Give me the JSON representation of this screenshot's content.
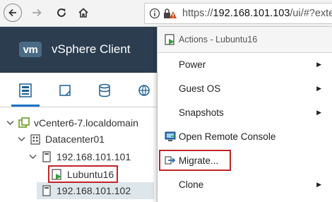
{
  "browser": {
    "address_scheme": "https://",
    "address_host": "192.168.101.103",
    "address_path": "/ui/#?exter"
  },
  "header": {
    "logo": "vm",
    "title": "vSphere Client"
  },
  "navigator": {
    "tabs": [
      "hosts-and-clusters",
      "vms-and-templates",
      "storage",
      "networking"
    ],
    "tree": {
      "vcenter": "vCenter6-7.localdomain",
      "datacenter": "Datacenter01",
      "host1": "192.168.101.101",
      "vm": "Lubuntu16",
      "host2": "192.168.101.102"
    }
  },
  "context_menu": {
    "header": "Actions - Lubuntu16",
    "items": [
      {
        "label": "Power",
        "submenu": true
      },
      {
        "label": "Guest OS",
        "submenu": true
      },
      {
        "label": "Snapshots",
        "submenu": true
      },
      {
        "label": "Open Remote Console",
        "submenu": false,
        "icon": "console-icon"
      },
      {
        "label": "Migrate...",
        "submenu": false,
        "icon": "migrate-icon"
      },
      {
        "label": "Clone",
        "submenu": true
      }
    ]
  },
  "colors": {
    "header_bg": "#2b3d4f",
    "highlight_border": "#c0252b",
    "vm_icon_green": "#3c9a3c"
  }
}
